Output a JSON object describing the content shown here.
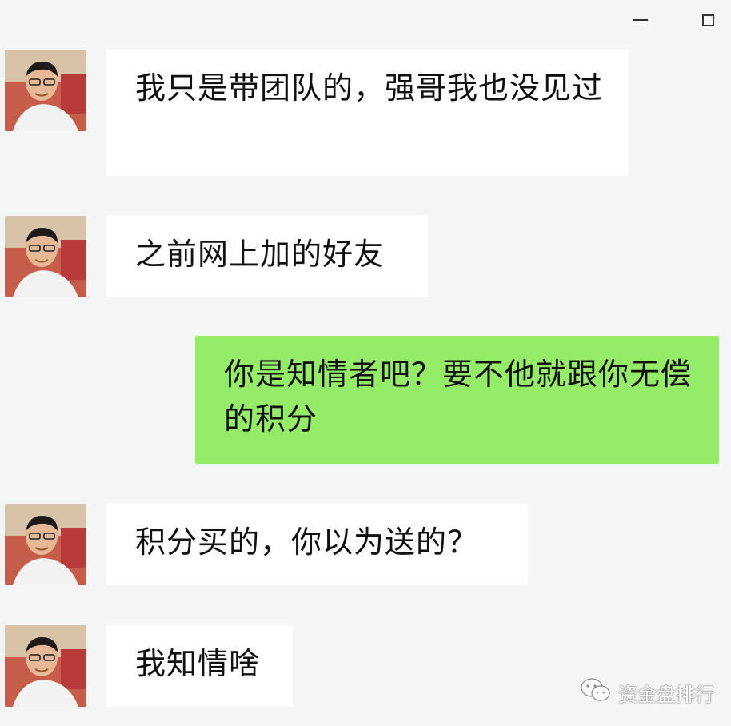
{
  "colors": {
    "background": "#f5f5f5",
    "incoming_bubble": "#ffffff",
    "outgoing_bubble": "#95ec69"
  },
  "window_controls": {
    "minimize_icon": "minimize-icon",
    "maximize_icon": "maximize-icon"
  },
  "messages": [
    {
      "from": "contact",
      "text": "我只是带团队的，强哥我也没见过"
    },
    {
      "from": "contact",
      "text": "之前网上加的好友"
    },
    {
      "from": "me",
      "text": "你是知情者吧？要不他就跟你无偿的积分"
    },
    {
      "from": "contact",
      "text": "积分买的，你以为送的？"
    },
    {
      "from": "contact",
      "text": "我知情啥"
    }
  ],
  "watermark": {
    "icon": "wechat-icon",
    "text": "资金盘排行"
  }
}
